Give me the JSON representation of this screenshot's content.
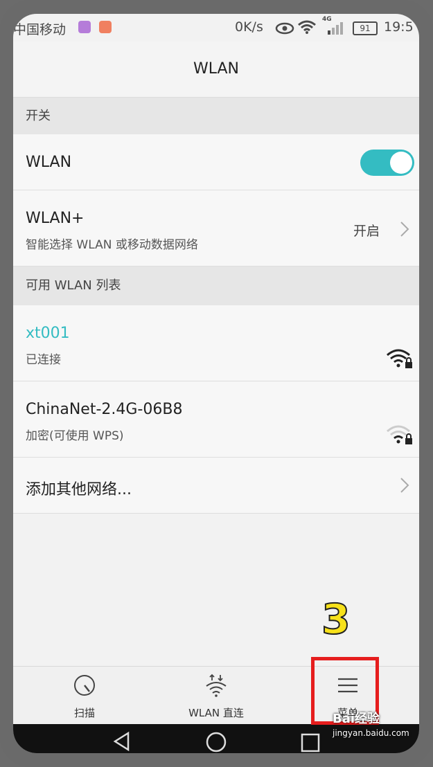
{
  "status_bar": {
    "carrier": "中国移动",
    "net_speed": "0K/s",
    "network_type": "4G",
    "battery": "91",
    "time": "19:5"
  },
  "title": "WLAN",
  "sections": {
    "switch_header": "开关",
    "list_header": "可用 WLAN 列表"
  },
  "wlan_row": {
    "label": "WLAN",
    "toggle_on": true
  },
  "wlan_plus": {
    "label": "WLAN+",
    "subtitle": "智能选择 WLAN 或移动数据网络",
    "status": "开启"
  },
  "networks": [
    {
      "ssid": "xt001",
      "status": "已连接"
    },
    {
      "ssid": "ChinaNet-2.4G-06B8",
      "status": "加密(可使用 WPS)"
    }
  ],
  "add_network": "添加其他网络...",
  "bottom_tabs": [
    {
      "label": "扫描"
    },
    {
      "label": "WLAN 直连"
    },
    {
      "label": "菜单"
    }
  ],
  "annotation": {
    "number": "3"
  },
  "watermark": {
    "brand": "Bai经验",
    "url": "jingyan.baidu.com"
  },
  "colors": {
    "accent": "#34bcc2",
    "highlight_box": "#e61e1e",
    "annotation": "#f7e11a"
  }
}
